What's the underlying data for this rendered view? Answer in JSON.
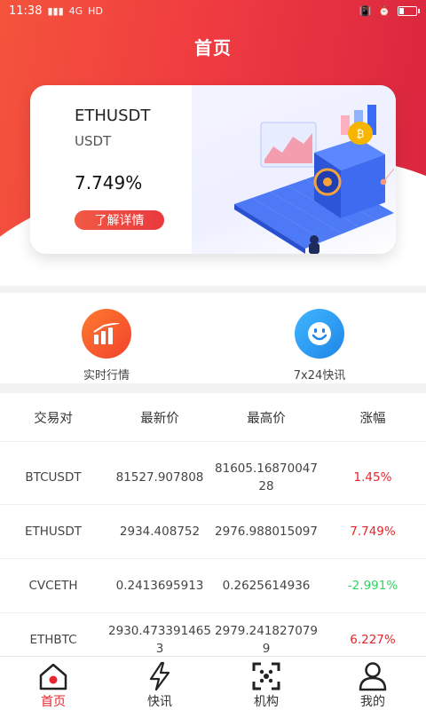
{
  "status_bar": {
    "time": "11:38",
    "network": "4G",
    "hd": "HD",
    "icons": [
      "signal-icon",
      "vibrate-icon",
      "alarm-icon",
      "battery-icon"
    ]
  },
  "header": {
    "title": "首页"
  },
  "feature_card": {
    "symbol": "ETHUSDT",
    "quote": "USDT",
    "value": "7.749%",
    "button_label": "了解详情"
  },
  "shortcuts": [
    {
      "label": "实时行情",
      "icon": "bar-chart-icon",
      "color": "#f24e2d"
    },
    {
      "label": "7x24快讯",
      "icon": "smiley-icon",
      "color": "#2a9ff0"
    }
  ],
  "table": {
    "headers": [
      "交易对",
      "最新价",
      "最高价",
      "涨幅"
    ],
    "rows": [
      {
        "pair": "BTCUSDT",
        "last": "81527.907808",
        "high": "81605.16870047\n28",
        "change": "1.45%",
        "trend": "up"
      },
      {
        "pair": "ETHUSDT",
        "last": "2934.408752",
        "high": "2976.988015097",
        "change": "7.749%",
        "trend": "up"
      },
      {
        "pair": "CVCETH",
        "last": "0.2413695913",
        "high": "0.2625614936",
        "change": "-2.991%",
        "trend": "down"
      },
      {
        "pair": "ETHBTC",
        "last": "2930.473391465\n3",
        "high": "2979.241827079\n9",
        "change": "6.227%",
        "trend": "up"
      }
    ]
  },
  "bottom_nav": [
    {
      "label": "首页",
      "icon": "home-icon",
      "active": true
    },
    {
      "label": "快讯",
      "icon": "lightning-icon",
      "active": false
    },
    {
      "label": "机构",
      "icon": "scan-icon",
      "active": false
    },
    {
      "label": "我的",
      "icon": "person-icon",
      "active": false
    }
  ],
  "colors": {
    "accent": "#e8393e",
    "up": "#e8252a",
    "down": "#2bd65e"
  }
}
